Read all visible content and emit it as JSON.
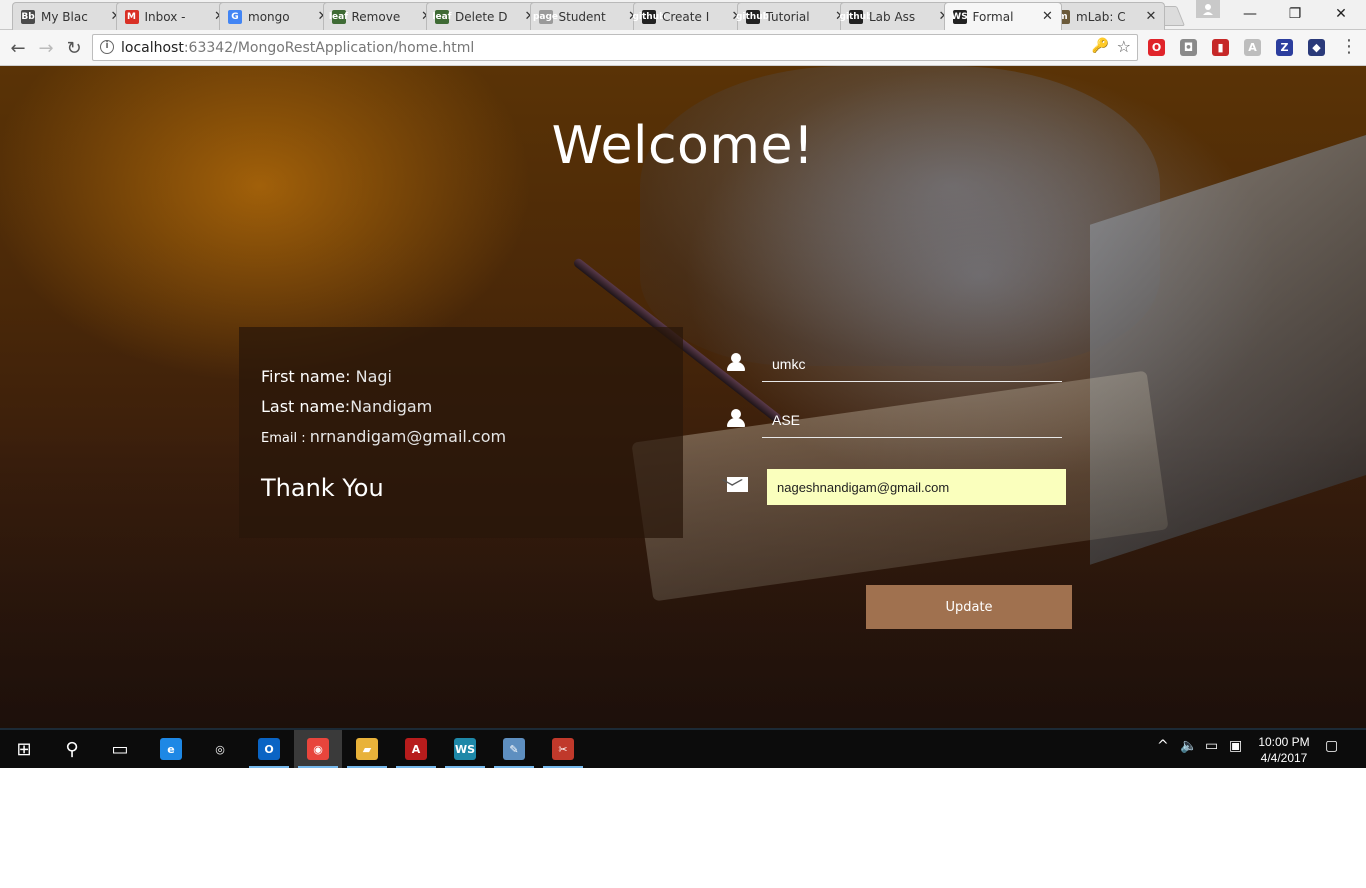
{
  "browser": {
    "tabs": [
      {
        "label": "My Blac",
        "favicon": "Bb",
        "favicon_color": "#4a4a4a",
        "active": false
      },
      {
        "label": "Inbox -",
        "favicon": "M",
        "favicon_color": "#d93025",
        "active": false
      },
      {
        "label": "mongo",
        "favicon": "G",
        "favicon_color": "#4285f4",
        "active": false
      },
      {
        "label": "Remove",
        "favicon": "leaf",
        "favicon_color": "#3f6b35",
        "active": false
      },
      {
        "label": "Delete D",
        "favicon": "leaf",
        "favicon_color": "#3f6b35",
        "active": false
      },
      {
        "label": "Student",
        "favicon": "page",
        "favicon_color": "#9a9a9a",
        "active": false
      },
      {
        "label": "Create I",
        "favicon": "github",
        "favicon_color": "#222222",
        "active": false
      },
      {
        "label": "Tutorial",
        "favicon": "github",
        "favicon_color": "#222222",
        "active": false
      },
      {
        "label": "Lab Ass",
        "favicon": "github",
        "favicon_color": "#222222",
        "active": false
      },
      {
        "label": "Formal",
        "favicon": "WS",
        "favicon_color": "#222222",
        "active": true
      },
      {
        "label": "mLab: C",
        "favicon": "m",
        "favicon_color": "#6b5a3a",
        "active": false
      }
    ],
    "close_glyph": "✕",
    "window_controls": {
      "minimize": "—",
      "restore": "❐",
      "close": "✕"
    },
    "nav": {
      "back": "←",
      "forward": "→",
      "reload": "↻"
    },
    "url_host": "localhost",
    "url_rest": ":63342/MongoRestApplication/home.html",
    "omnibox_icons": {
      "info": "i",
      "key": "🔑",
      "star": "☆"
    },
    "extensions": [
      {
        "name": "opera-icon",
        "glyph": "O",
        "color": "#e0242a"
      },
      {
        "name": "extension-grey-icon",
        "glyph": "◘",
        "color": "#8a8a8a"
      },
      {
        "name": "bookmark-red-icon",
        "glyph": "▮",
        "color": "#c62828"
      },
      {
        "name": "pdf-icon",
        "glyph": "A",
        "color": "#bdbdbd"
      },
      {
        "name": "zotero-icon",
        "glyph": "Z",
        "color": "#2c3e9e"
      },
      {
        "name": "chart-extension-icon",
        "glyph": "◆",
        "color": "#2a3a7a"
      }
    ],
    "menu": "⋮"
  },
  "page": {
    "heading": "Welcome!",
    "card": {
      "first_name_label": "First name: ",
      "first_name_value": "Nagi",
      "last_name_label": "Last name:",
      "last_name_value": "Nandigam",
      "email_label": "Email : ",
      "email_value": "nrnandigam@gmail.com",
      "thanks": "Thank You"
    },
    "form": {
      "first_field_value": "umkc",
      "second_field_value": "ASE",
      "email_field_value": "nageshnandigam@gmail.com",
      "update_label": "Update"
    }
  },
  "taskbar": {
    "apps": [
      {
        "name": "start-button",
        "glyph": "⊞",
        "color": "#0c0c0c",
        "active": false,
        "underline": false
      },
      {
        "name": "search-button",
        "glyph": "⚲",
        "color": "#0c0c0c",
        "active": false,
        "underline": false
      },
      {
        "name": "task-view-button",
        "glyph": "▭",
        "color": "#0c0c0c",
        "active": false,
        "underline": false
      },
      {
        "name": "edge-icon",
        "glyph": "e",
        "color": "#1e88e5",
        "active": false,
        "underline": false
      },
      {
        "name": "groove-icon",
        "glyph": "◎",
        "color": "#0c0c0c",
        "active": false,
        "underline": false
      },
      {
        "name": "outlook-icon",
        "glyph": "O",
        "color": "#0a64c4",
        "active": false,
        "underline": true
      },
      {
        "name": "chrome-icon",
        "glyph": "◉",
        "color": "#e8453c",
        "active": true,
        "underline": true
      },
      {
        "name": "file-explorer-icon",
        "glyph": "▰",
        "color": "#e8b23a",
        "active": false,
        "underline": true
      },
      {
        "name": "acrobat-icon",
        "glyph": "A",
        "color": "#b71c1c",
        "active": false,
        "underline": true
      },
      {
        "name": "webstorm-icon",
        "glyph": "WS",
        "color": "#1e88a8",
        "active": false,
        "underline": true
      },
      {
        "name": "paint-icon",
        "glyph": "✎",
        "color": "#5e8fc0",
        "active": false,
        "underline": true
      },
      {
        "name": "snipping-tool-icon",
        "glyph": "✂",
        "color": "#c0392b",
        "active": false,
        "underline": true
      }
    ],
    "tray": {
      "chevron": "^",
      "volume": "🔈",
      "battery": "▭",
      "network": "▣",
      "notifications": "▢"
    },
    "time": "10:00 PM",
    "date": "4/4/2017"
  }
}
